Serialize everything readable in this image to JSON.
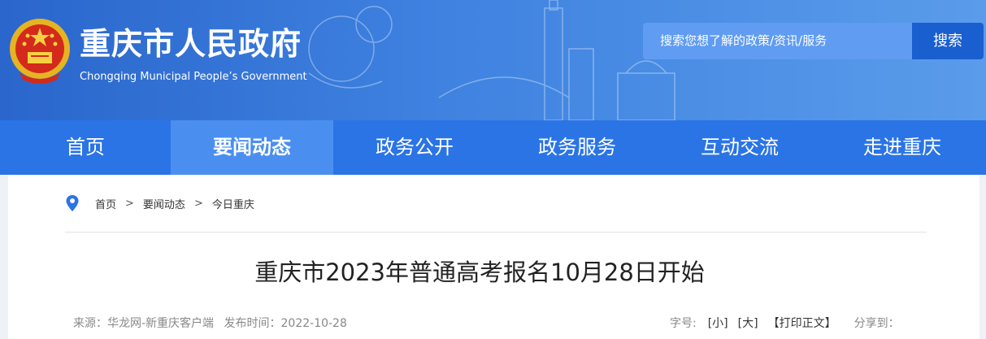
{
  "header": {
    "title": "重庆市人民政府",
    "subtitle": "Chongqing Municipal People’s Government",
    "search_placeholder": "搜索您想了解的政策/资讯/服务",
    "search_button": "搜索",
    "colors": {
      "header": "#2a66cc",
      "nav": "#2a74e6",
      "nav_active": "#4a8ff0",
      "search_button": "#1a5fd0"
    }
  },
  "nav": {
    "items": [
      {
        "label": "首页"
      },
      {
        "label": "要闻动态",
        "active": true
      },
      {
        "label": "政务公开"
      },
      {
        "label": "政务服务"
      },
      {
        "label": "互动交流"
      },
      {
        "label": "走进重庆"
      }
    ]
  },
  "breadcrumb": {
    "items": [
      "首页",
      "要闻动态",
      "今日重庆"
    ],
    "separator": ">"
  },
  "article": {
    "title": "重庆市2023年普通高考报名10月28日开始",
    "source": "来源：华龙网-新重庆客户端",
    "published": "发布时间：2022-10-28",
    "font_size_label": "字号:",
    "small": "[小]",
    "large": "[大]",
    "print": "【打印正文】",
    "share": "分享到："
  }
}
